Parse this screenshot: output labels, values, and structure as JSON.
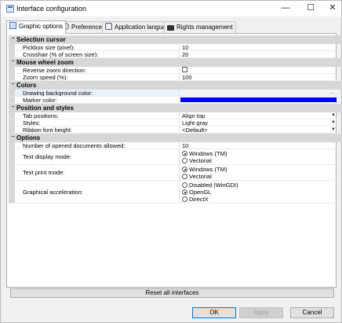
{
  "window": {
    "title": "Interface configuration",
    "controls": {
      "minimize": "—",
      "maximize": "☐",
      "close": "✕"
    }
  },
  "tabs": [
    {
      "label": "Graphic options",
      "icon": "graphic-options-icon",
      "active": true
    },
    {
      "label": "Preferences",
      "icon": "preferences-icon",
      "active": false
    },
    {
      "label": "Application language",
      "icon": "language-icon",
      "active": false
    },
    {
      "label": "Rights management",
      "icon": "lock-icon",
      "active": false
    }
  ],
  "grid": {
    "selection_cursor": {
      "title": "Selection cursor",
      "pickbox_label": "Pickbox size (pixel):",
      "pickbox_value": "10",
      "crosshair_label": "Crosshair (% of screen size):",
      "crosshair_value": "20"
    },
    "mouse_wheel": {
      "title": "Mouse wheel zoom",
      "reverse_label": "Reverse zoom direction:",
      "reverse_checked": false,
      "speed_label": "Zoom speed (%):",
      "speed_value": "100"
    },
    "colors": {
      "title": "Colors",
      "bg_label": "Drawing background color:",
      "bg_value": "",
      "marker_label": "Marker color:",
      "marker_color": "#0000ff"
    },
    "position_styles": {
      "title": "Position and styles",
      "tab_pos_label": "Tab positions:",
      "tab_pos_value": "Align top",
      "styles_label": "Styles:",
      "styles_value": "Light gray",
      "ribbon_label": "Ribbon font height:",
      "ribbon_value": "<Default>"
    },
    "options": {
      "title": "Options",
      "docs_label": "Number of opened documents allowed:",
      "docs_value": "10",
      "text_display_label": "Text display mode:",
      "text_display_options": [
        "Windows (TM)",
        "Vectorial"
      ],
      "text_display_selected": 0,
      "text_print_label": "Text print mode:",
      "text_print_options": [
        "Windows (TM)",
        "Vectorial"
      ],
      "text_print_selected": 0,
      "graphic_accel_label": "Graphical acceleration:",
      "graphic_accel_options": [
        "Disabled (WinGDI)",
        "OpenGL",
        "DirectX"
      ],
      "graphic_accel_selected": 1
    }
  },
  "reset_button": "Reset all interfaces",
  "buttons": {
    "ok": "OK",
    "apply": "Apply",
    "cancel": "Cancel"
  }
}
